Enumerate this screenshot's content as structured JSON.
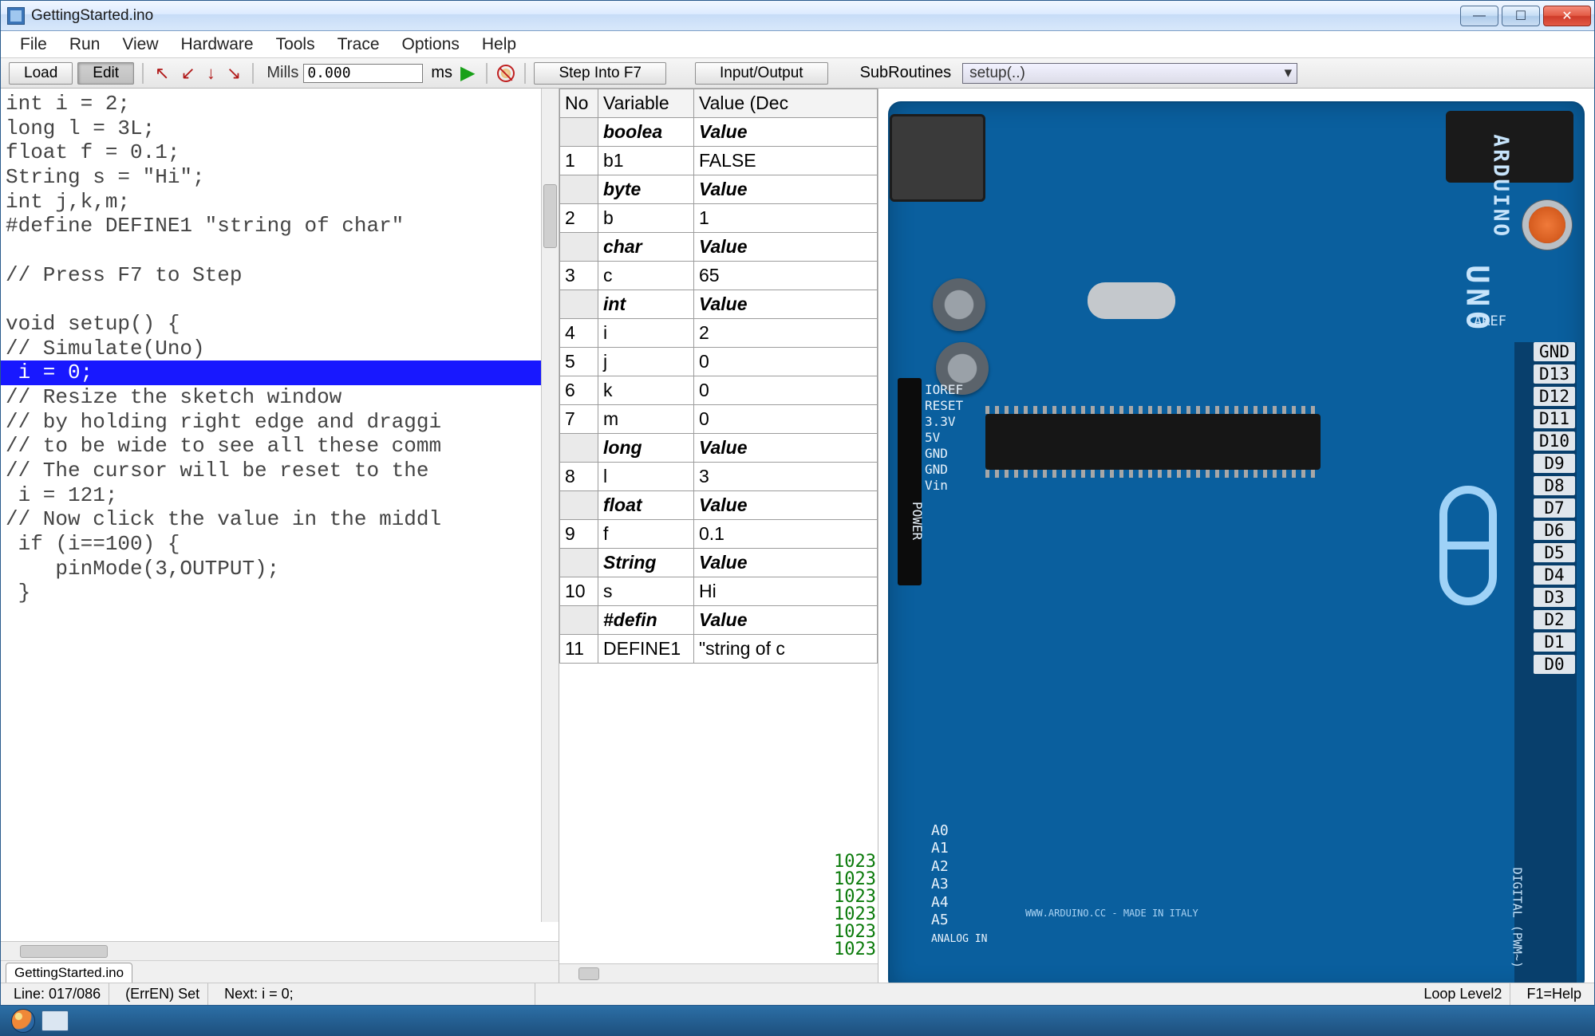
{
  "window": {
    "title": "GettingStarted.ino"
  },
  "menu": [
    "File",
    "Run",
    "View",
    "Hardware",
    "Tools",
    "Trace",
    "Options",
    "Help"
  ],
  "toolbar": {
    "load": "Load",
    "edit": "Edit",
    "mills_label": "Mills",
    "mills_value": "0.000",
    "ms_label": "ms",
    "step_into": "Step Into F7",
    "io": "Input/Output",
    "subroutines_label": "SubRoutines",
    "subroutines_value": "setup(..)"
  },
  "code_lines": [
    "int i = 2;",
    "long l = 3L;",
    "float f = 0.1;",
    "String s = \"Hi\";",
    "int j,k,m;",
    "#define DEFINE1 \"string of char\"",
    "",
    "// Press F7 to Step",
    "",
    "void setup() {",
    "// Simulate(Uno)"
  ],
  "code_highlight": " i = 0;",
  "code_lines_after": [
    "// Resize the sketch window",
    "// by holding right edge and draggi",
    "// to be wide to see all these comm",
    "// The cursor will be reset to the",
    " i = 121;",
    "// Now click the value in the middl",
    " if (i==100) {",
    "    pinMode(3,OUTPUT);",
    " }"
  ],
  "file_tab": "GettingStarted.ino",
  "var_headers": {
    "no": "No",
    "var": "Variable",
    "val": "Value (Dec"
  },
  "var_rows": [
    {
      "section": true,
      "no": "",
      "var": "boolea",
      "val": "Value"
    },
    {
      "section": false,
      "no": "1",
      "var": "b1",
      "val": "FALSE"
    },
    {
      "section": true,
      "no": "",
      "var": "byte",
      "val": "Value"
    },
    {
      "section": false,
      "no": "2",
      "var": "b",
      "val": "1"
    },
    {
      "section": true,
      "no": "",
      "var": "char",
      "val": "Value"
    },
    {
      "section": false,
      "no": "3",
      "var": "c",
      "val": "65"
    },
    {
      "section": true,
      "no": "",
      "var": "int",
      "val": "Value"
    },
    {
      "section": false,
      "no": "4",
      "var": "i",
      "val": "2"
    },
    {
      "section": false,
      "no": "5",
      "var": "j",
      "val": "0"
    },
    {
      "section": false,
      "no": "6",
      "var": "k",
      "val": "0"
    },
    {
      "section": false,
      "no": "7",
      "var": "m",
      "val": "0"
    },
    {
      "section": true,
      "no": "",
      "var": "long",
      "val": "Value"
    },
    {
      "section": false,
      "no": "8",
      "var": "l",
      "val": "3"
    },
    {
      "section": true,
      "no": "",
      "var": "float",
      "val": "Value"
    },
    {
      "section": false,
      "no": "9",
      "var": "f",
      "val": "0.1"
    },
    {
      "section": true,
      "no": "",
      "var": "String",
      "val": "Value"
    },
    {
      "section": false,
      "no": "10",
      "var": "s",
      "val": "Hi"
    },
    {
      "section": true,
      "no": "",
      "var": "#defin",
      "val": "Value"
    },
    {
      "section": false,
      "no": "11",
      "var": "DEFINE1",
      "val": "\"string of c"
    }
  ],
  "analog_readings": [
    "1023",
    "1023",
    "1023",
    "1023",
    "1023",
    "1023"
  ],
  "board": {
    "brand": "ARDUINO",
    "model": "UNO",
    "aref": "AREF",
    "gnd": "GND",
    "silks": [
      "IOREF",
      "RESET",
      "3.3V",
      "5V",
      "GND",
      "GND",
      "Vin"
    ],
    "power_label": "POWER",
    "digital_label": "DIGITAL (PWM~)",
    "analog_label": "ANALOG IN",
    "analog_pins": [
      "A0",
      "A1",
      "A2",
      "A3",
      "A4",
      "A5"
    ],
    "digital_pins": [
      "D13",
      "D12",
      "D11",
      "D10",
      "D9",
      "D8",
      "D7",
      "D6",
      "D5",
      "D4",
      "D3",
      "D2",
      "D1",
      "D0"
    ],
    "madein": "WWW.ARDUINO.CC - MADE IN ITALY"
  },
  "status": {
    "line": "Line: 017/086",
    "err": "(ErrEN) Set",
    "next": "Next: i = 0;",
    "loop": "Loop Level2",
    "help": "F1=Help"
  }
}
